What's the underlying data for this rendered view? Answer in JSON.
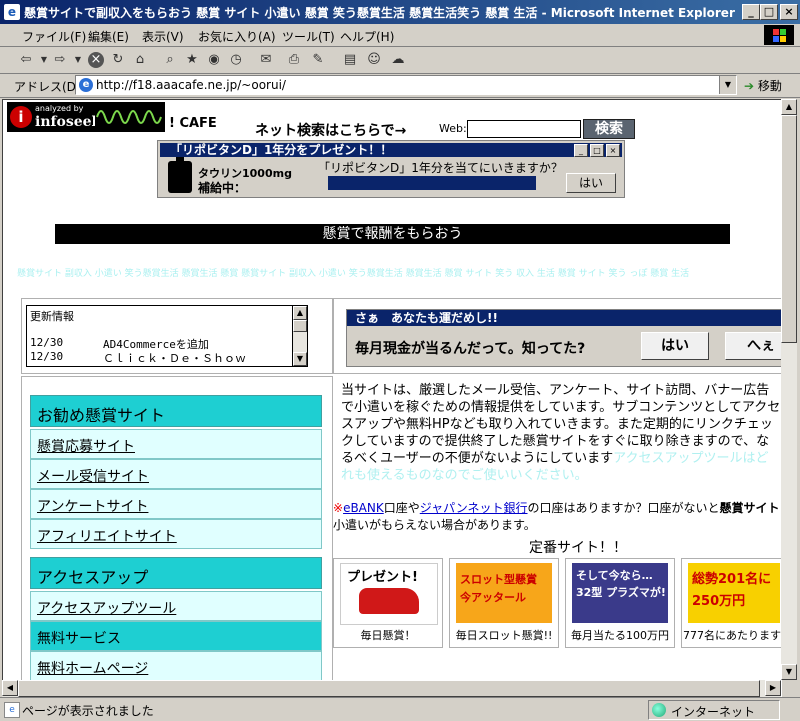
{
  "window": {
    "title": "懸賞サイトで副収入をもらおう 懸賞 サイト 小遣い 懸賞 笑う懸賞生活 懸賞生活笑う 懸賞 生活 - Microsoft Internet Explorer"
  },
  "menu": [
    "ファイル(F)",
    "編集(E)",
    "表示(V)",
    "お気に入り(A)",
    "ツール(T)",
    "ヘルプ(H)"
  ],
  "address": {
    "label": "アドレス(D)",
    "url": "http://f18.aaacafe.ne.jp/~oorui/",
    "go": "移動"
  },
  "status": {
    "text": "ページが表示されました",
    "zone": "インターネット"
  },
  "header": {
    "logo_small": "analyzed by",
    "logo_big": "infoseek",
    "cafe": "! CAFE",
    "search_text": "ネット検索はこちらで→",
    "web_label": "Web:",
    "search_button": "検索"
  },
  "popup": {
    "title": "「リポビタンD」1年分をプレゼント！！",
    "taurin": "タウリン1000mg",
    "hokyu": "補給中：",
    "question": "「リポビタンD」1年分を当てにいきますか？",
    "yes": "はい"
  },
  "banner": {
    "text": "懸賞で報酬をもらおう",
    "keywords": "懸賞サイト 副収入 小遣い 笑う懸賞生活 懸賞生活 懸賞 懸賞サイト 副収入 小遣い 笑う懸賞生活 懸賞生活 懸賞 サイト 笑う 収入 生活 懸賞 サイト 笑う っぽ 懸賞 生活"
  },
  "updates": {
    "label": "更新情報",
    "rows": [
      {
        "date": "12/30",
        "text": "AD4Commerceを追加"
      },
      {
        "date": "12/30",
        "text": "Ｃｌｉｃｋ・Ｄｅ・Ｓｈｏｗ"
      }
    ]
  },
  "luck": {
    "title": "さぁ　あなたも運だめし!!",
    "question": "毎月現金が当るんだって。知ってた?",
    "yes": "はい",
    "no": "へぇ"
  },
  "nav": {
    "sections": [
      {
        "title": "お勧め懸賞サイト",
        "items": [
          "懸賞応募サイト",
          "メール受信サイト",
          "アンケートサイト",
          "アフィリエイトサイト"
        ]
      },
      {
        "title": "アクセスアップ",
        "items": [
          "アクセスアップツール"
        ]
      }
    ],
    "free_header": "無料サービス",
    "free_items": [
      "無料ホームページ"
    ]
  },
  "intro": {
    "text": "当サイトは、厳選したメール受信、アンケート、サイト訪問、バナー広告で小遣いを稼ぐための情報提供をしています。サブコンテンツとしてアクセスアップや無料HPなども取り入れていきます。また定期的にリンクチェックしていますので提供終了した懸賞サイトをすぐに取り除きますので、なるべくユーザーの不便がないようにしています",
    "fade": "アクセスアップツールはどれも使えるものなのでご使いいください。"
  },
  "bank": {
    "mark": "※",
    "ebank": "eBANK",
    "mid1": "口座や",
    "japannet": "ジャパンネット銀行",
    "mid2": "の口座はありますか？口座がないと",
    "bold": "懸賞サイト",
    "line2": "小遣いがもらえない場合があります。"
  },
  "teiban": "定番サイト！！",
  "sites": [
    {
      "banner": "プレゼント!",
      "caption": "毎日懸賞！"
    },
    {
      "banner": "スロット型懸賞 今アッタール",
      "caption": "毎日スロット懸賞!!"
    },
    {
      "banner": "そして今なら… 32型 プラズマが!",
      "caption": "毎月当たる100万円"
    },
    {
      "banner": "総勢201名に 250万円",
      "caption": "777名にあたります"
    }
  ],
  "colors": {
    "titlebar": "#0a246a",
    "nav_header": "#1ecfd2",
    "nav_item": "#e0ffff"
  }
}
